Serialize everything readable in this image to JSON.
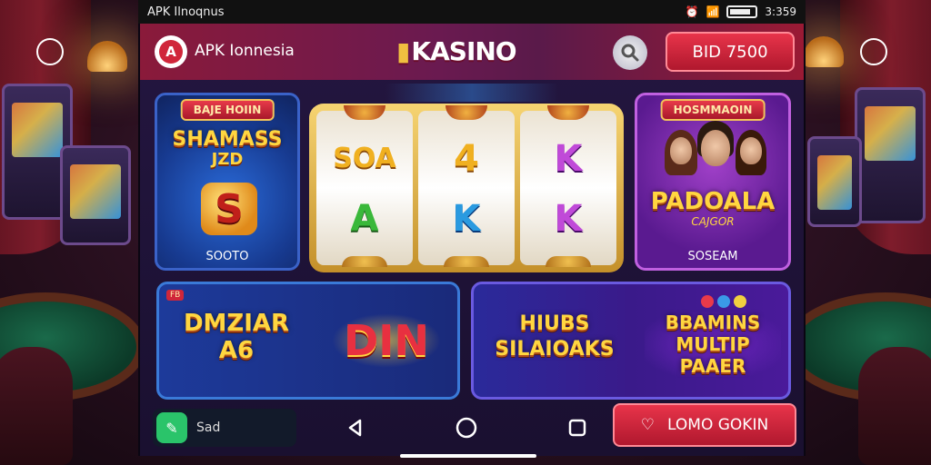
{
  "status_bar": {
    "carrier": "APK Ilnoqnus",
    "time": "3:359"
  },
  "header": {
    "brand_name": "APK Ionnesia",
    "logo_text": "KASINO",
    "balance_button": "BID 7500"
  },
  "tiles": {
    "tile_a": {
      "ribbon": "BAJE HOIIN",
      "title": "SHAMASS",
      "subtitle": "JZD",
      "coin": "S",
      "caption": "SOOTO"
    },
    "slot": {
      "reels": [
        [
          "SOA",
          "A"
        ],
        [
          "4",
          "K"
        ],
        [
          "K",
          "K"
        ]
      ]
    },
    "tile_c": {
      "ribbon": "HOSMMAOIN",
      "title": "PADOALA",
      "subtitle": "CAJGOR",
      "caption": "SOSEAM"
    },
    "tile_d": {
      "tag": "FB",
      "title": "DMZIAR A6",
      "badge": "DIN"
    },
    "tile_e": {
      "title": "HIUBS SILAIOAKS",
      "badge": "BBAMINS MULTIP PAAER"
    }
  },
  "bottom_bar": {
    "chat_label": "Sad",
    "cta_label": "LOMO GOKIN"
  },
  "colors": {
    "accent": "#d0263a",
    "gold": "#ffd640",
    "frame": "#241640"
  }
}
